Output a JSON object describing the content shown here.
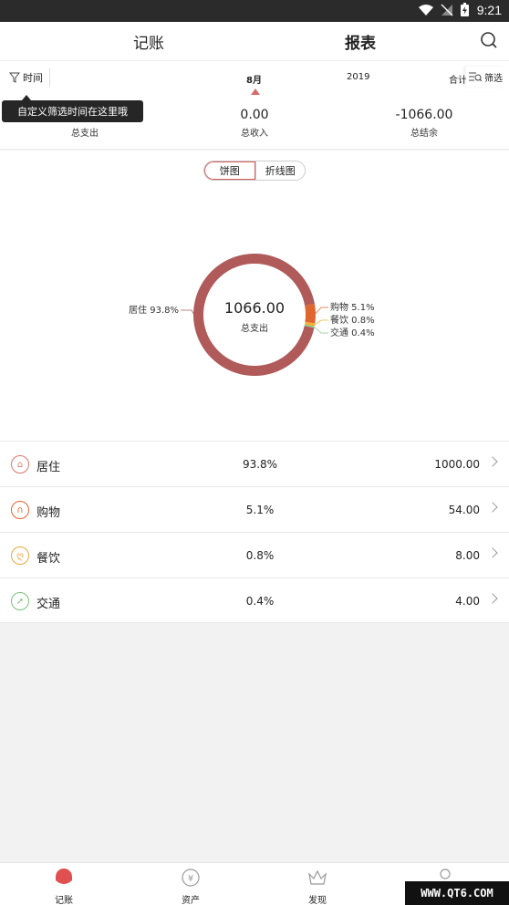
{
  "status": {
    "time": "9:21"
  },
  "header": {
    "tab_jizhang": "记账",
    "tab_baobiao": "报表"
  },
  "filter": {
    "time_label": "时间",
    "month": "8月",
    "year": "2019",
    "heji": "合计",
    "filter_label": "筛选"
  },
  "tooltip": "自定义筛选时间在这里哦",
  "summary": {
    "expense_label": "总支出",
    "income_value": "0.00",
    "income_label": "总收入",
    "balance_value": "-1066.00",
    "balance_label": "总结余"
  },
  "chart_toggle": {
    "pie": "饼图",
    "line": "折线图"
  },
  "chart_data": {
    "type": "pie",
    "center_value": "1066.00",
    "center_label": "总支出",
    "slices": [
      {
        "name": "居住",
        "pct": 93.8,
        "label": "居住 93.8%",
        "color": "#b05a5a"
      },
      {
        "name": "购物",
        "pct": 5.1,
        "label": "购物 5.1%",
        "color": "#e0662f"
      },
      {
        "name": "餐饮",
        "pct": 0.8,
        "label": "餐饮 0.8%",
        "color": "#f2b233"
      },
      {
        "name": "交通",
        "pct": 0.4,
        "label": "交通 0.4%",
        "color": "#8cc98a"
      }
    ]
  },
  "categories": [
    {
      "name": "居住",
      "pct": "93.8%",
      "amount": "1000.00",
      "color": "#d9776e",
      "icon": "house-icon"
    },
    {
      "name": "购物",
      "pct": "5.1%",
      "amount": "54.00",
      "color": "#e0662f",
      "icon": "bag-icon"
    },
    {
      "name": "餐饮",
      "pct": "0.8%",
      "amount": "8.00",
      "color": "#e8a640",
      "icon": "food-icon"
    },
    {
      "name": "交通",
      "pct": "0.4%",
      "amount": "4.00",
      "color": "#7cc07a",
      "icon": "plane-icon"
    }
  ],
  "bottomnav": {
    "jizhang": "记账",
    "zichan": "资产",
    "faxian": "发现"
  },
  "watermark": "WWW.QT6.COM"
}
